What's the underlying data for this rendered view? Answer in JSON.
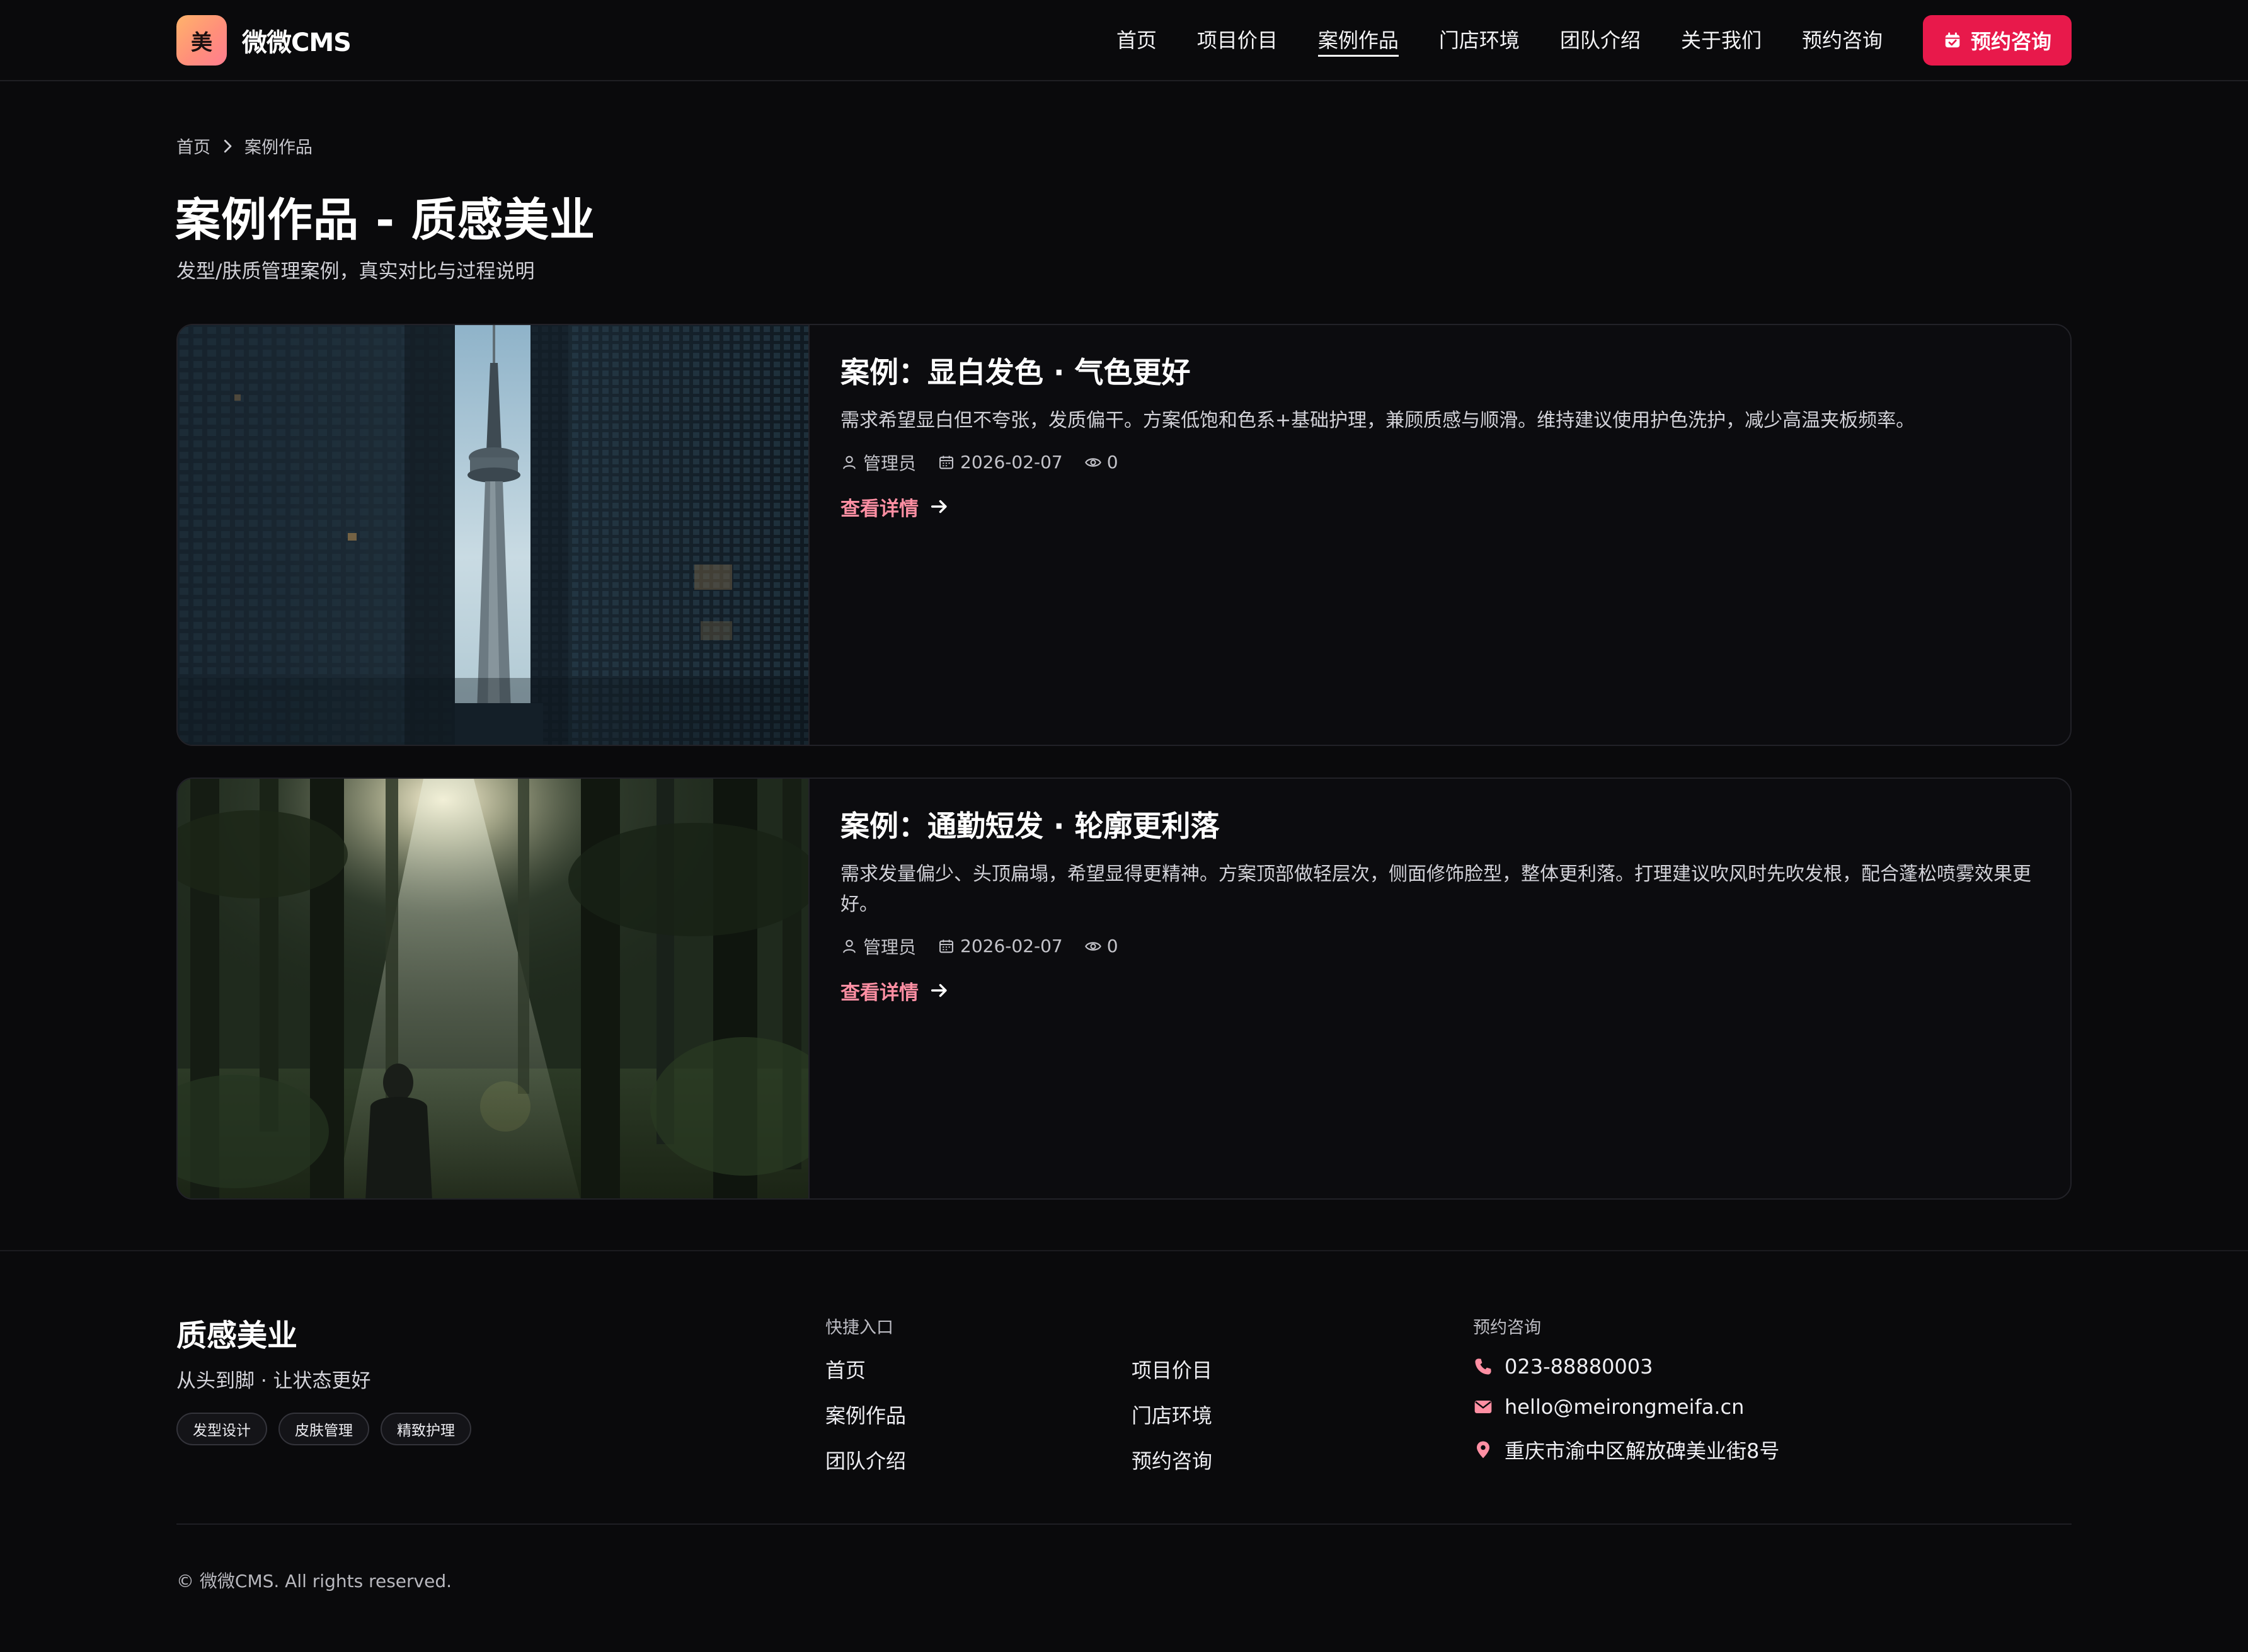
{
  "header": {
    "logo_char": "美",
    "logo_text": "微微CMS",
    "nav": [
      {
        "label": "首页",
        "active": false
      },
      {
        "label": "项目价目",
        "active": false
      },
      {
        "label": "案例作品",
        "active": true
      },
      {
        "label": "门店环境",
        "active": false
      },
      {
        "label": "团队介绍",
        "active": false
      },
      {
        "label": "关于我们",
        "active": false
      },
      {
        "label": "预约咨询",
        "active": false
      }
    ],
    "cta_label": "预约咨询",
    "cta_icon": "calendar-check-icon"
  },
  "breadcrumb": {
    "home": "首页",
    "current": "案例作品"
  },
  "page": {
    "title": "案例作品 - 质感美业",
    "subtitle": "发型/肤质管理案例，真实对比与过程说明"
  },
  "cases": [
    {
      "title": "案例：显白发色 · 气色更好",
      "description": "需求希望显白但不夸张，发质偏干。方案低饱和色系+基础护理，兼顾质感与顺滑。维持建议使用护色洗护，减少高温夹板频率。",
      "author": "管理员",
      "date": "2026-02-07",
      "views": "0",
      "link_label": "查看详情",
      "image": "city-tower-photo"
    },
    {
      "title": "案例：通勤短发 · 轮廓更利落",
      "description": "需求发量偏少、头顶扁塌，希望显得更精神。方案顶部做轻层次，侧面修饰脸型，整体更利落。打理建议吹风时先吹发根，配合蓬松喷雾效果更好。",
      "author": "管理员",
      "date": "2026-02-07",
      "views": "0",
      "link_label": "查看详情",
      "image": "forest-light-photo"
    }
  ],
  "footer": {
    "brand": "质感美业",
    "slogan": "从头到脚 · 让状态更好",
    "tags": [
      "发型设计",
      "皮肤管理",
      "精致护理"
    ],
    "quick_title": "快捷入口",
    "quick_links": [
      "首页",
      "项目价目",
      "案例作品",
      "门店环境",
      "团队介绍",
      "预约咨询"
    ],
    "contact_title": "预约咨询",
    "phone": "023-88880003",
    "email": "hello@meirongmeifa.cn",
    "address": "重庆市渝中区解放碑美业街8号",
    "copyright": "© 微微CMS. All rights reserved."
  },
  "colors": {
    "background": "#0a0a0c",
    "accent": "#e8194b",
    "link": "#ff8fa3",
    "logo_gradient": [
      "#ffb36b",
      "#ff7d8f"
    ]
  }
}
